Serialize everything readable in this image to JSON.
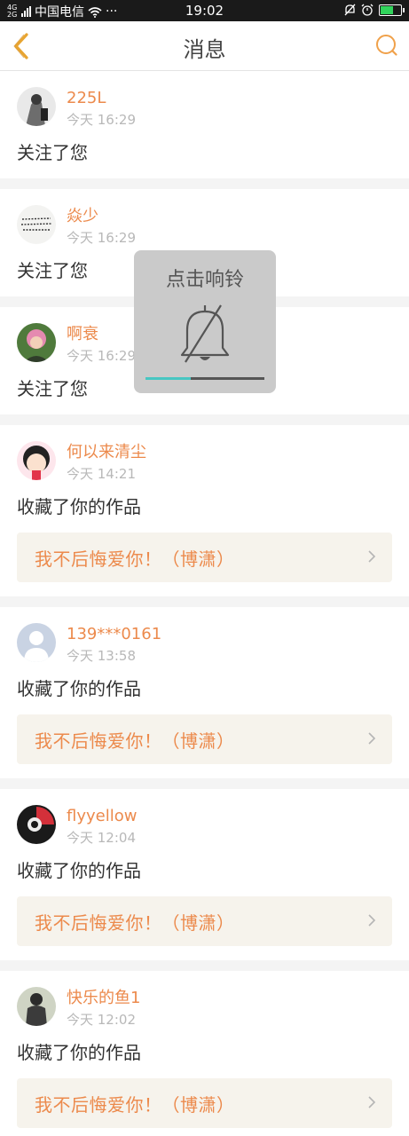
{
  "status_bar": {
    "signal_top": "4G",
    "signal_bottom": "2G",
    "carrier": "中国电信",
    "more": "···",
    "time": "19:02"
  },
  "nav": {
    "title": "消息",
    "back_icon": "chevron-left-icon",
    "search_icon": "search-icon",
    "accent": "#e8a532"
  },
  "accent_color": "#ec8a4c",
  "toast": {
    "title": "点击响铃",
    "icon": "bell-muted-icon",
    "progress": 0.38,
    "progress_color": "#47c6c2"
  },
  "messages": [
    {
      "user": "225L",
      "time": "今天 16:29",
      "action": "关注了您",
      "work": null
    },
    {
      "user": "焱少",
      "time": "今天 16:29",
      "action": "关注了您",
      "work": null
    },
    {
      "user": "啊衰",
      "time": "今天 16:29",
      "action": "关注了您",
      "work": null
    },
    {
      "user": "何以来清尘",
      "time": "今天 14:21",
      "action": "收藏了你的作品",
      "work": "我不后悔爱你！（博潇）"
    },
    {
      "user": "139***0161",
      "time": "今天 13:58",
      "action": "收藏了你的作品",
      "work": "我不后悔爱你！（博潇）"
    },
    {
      "user": "flyyellow",
      "time": "今天 12:04",
      "action": "收藏了你的作品",
      "work": "我不后悔爱你！（博潇）"
    },
    {
      "user": "快乐的鱼1",
      "time": "今天 12:02",
      "action": "收藏了你的作品",
      "work": "我不后悔爱你！（博潇）"
    }
  ]
}
